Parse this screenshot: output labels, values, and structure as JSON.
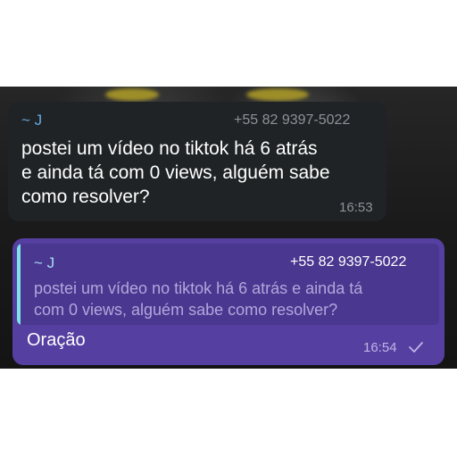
{
  "incoming": {
    "sender": "~ J",
    "phone": "+55 82 9397-5022",
    "line1": "postei um vídeo no tiktok há 6 atrás",
    "line2": "e ainda tá com 0 views, alguém sabe",
    "line3": "como resolver?",
    "time": "16:53"
  },
  "outgoing": {
    "quote": {
      "sender": "~ J",
      "phone": "+55 82 9397-5022",
      "line1": "postei um vídeo no tiktok há 6 atrás e ainda tá",
      "line2": "com 0 views, alguém sabe como resolver?"
    },
    "text": "Oração",
    "time": "16:54",
    "status_icon": "check-icon"
  },
  "colors": {
    "incoming_bubble": "#1f2326",
    "outgoing_bubble": "#553fa0",
    "quote_accent": "#7de3e6",
    "sender_name": "#66a9e0"
  }
}
